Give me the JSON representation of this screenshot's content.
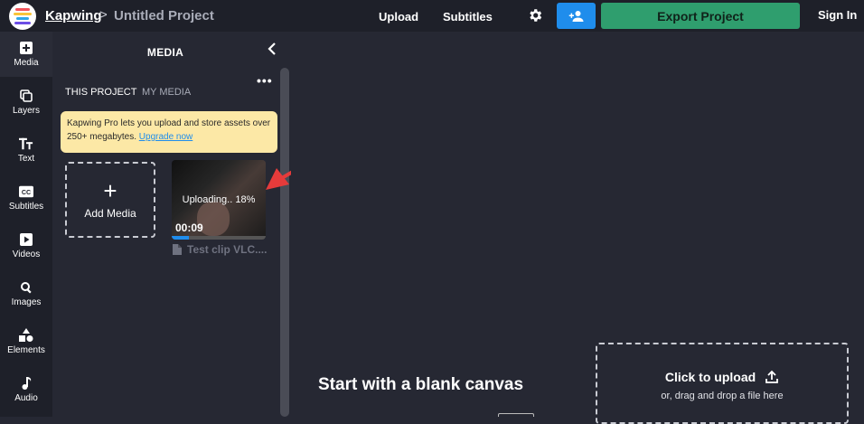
{
  "header": {
    "brand": "Kapwing",
    "separator": ">",
    "project_name": "Untitled Project",
    "nav_upload": "Upload",
    "nav_subtitles": "Subtitles",
    "export_label": "Export Project",
    "signin_label": "Sign In",
    "colors": {
      "share": "#1f8dec",
      "export": "#2f9e6e"
    }
  },
  "rail": {
    "items": [
      {
        "label": "Media",
        "icon": "media-plus-icon"
      },
      {
        "label": "Layers",
        "icon": "layers-icon"
      },
      {
        "label": "Text",
        "icon": "text-tt-icon"
      },
      {
        "label": "Subtitles",
        "icon": "cc-icon"
      },
      {
        "label": "Videos",
        "icon": "play-icon"
      },
      {
        "label": "Images",
        "icon": "search-icon"
      },
      {
        "label": "Elements",
        "icon": "shapes-icon"
      },
      {
        "label": "Audio",
        "icon": "music-note-icon"
      }
    ]
  },
  "panel": {
    "title": "MEDIA",
    "more": "•••",
    "tabs": [
      "THIS PROJECT",
      "MY MEDIA"
    ],
    "promo_text": "Kapwing Pro lets you upload and store assets over 250+ megabytes.",
    "promo_link": "Upgrade now",
    "add_media_label": "Add Media",
    "upload": {
      "status": "Uploading.. 18%",
      "progress": 0.18,
      "duration": "00:09",
      "file_name": "Test clip VLC...."
    }
  },
  "canvas": {
    "blank_title": "Start with a blank canvas",
    "drop_main": "Click to upload",
    "drop_sub": "or, drag and drop a file here"
  }
}
